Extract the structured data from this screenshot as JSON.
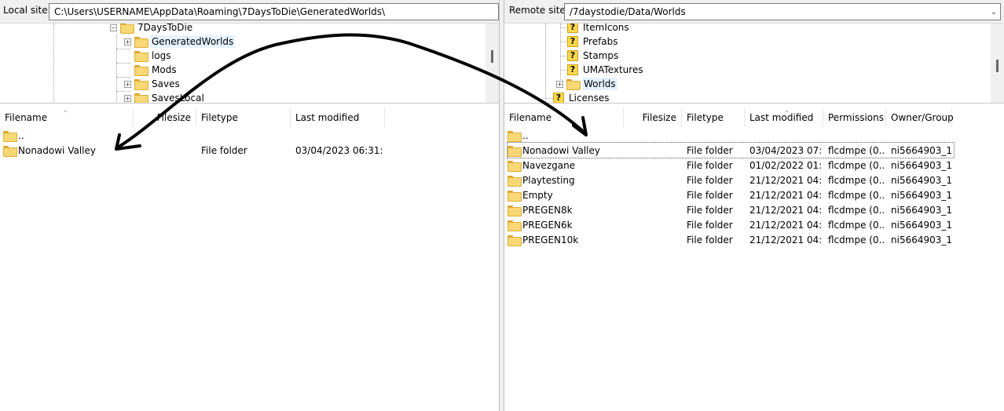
{
  "local": {
    "label": "Local site:",
    "path": "C:\\Users\\USERNAME\\AppData\\Roaming\\7DaysToDie\\GeneratedWorlds\\",
    "tree": [
      {
        "name": "7DaysToDie",
        "expander": "minus",
        "icon": "folder-icon",
        "selected": false
      },
      {
        "name": "GeneratedWorlds",
        "expander": "plus",
        "icon": "folder-icon",
        "selected": true
      },
      {
        "name": "logs",
        "expander": "none",
        "icon": "folder-icon",
        "selected": false
      },
      {
        "name": "Mods",
        "expander": "none",
        "icon": "folder-icon",
        "selected": false
      },
      {
        "name": "Saves",
        "expander": "plus",
        "icon": "folder-icon",
        "selected": false
      },
      {
        "name": "SavesLocal",
        "expander": "plus",
        "icon": "folder-icon",
        "selected": false
      }
    ],
    "columns": [
      "Filename",
      "Filesize",
      "Filetype",
      "Last modified"
    ],
    "files": [
      {
        "name": "..",
        "size": "",
        "type": "",
        "modified": ""
      },
      {
        "name": "Nonadowi Valley",
        "size": "",
        "type": "File folder",
        "modified": "03/04/2023 06:31:1..."
      }
    ]
  },
  "remote": {
    "label": "Remote site:",
    "path": "/7daystodie/Data/Worlds",
    "tree": [
      {
        "name": "ItemIcons",
        "expander": "none",
        "icon": "unknown-folder-icon",
        "selected": false
      },
      {
        "name": "Prefabs",
        "expander": "none",
        "icon": "unknown-folder-icon",
        "selected": false
      },
      {
        "name": "Stamps",
        "expander": "none",
        "icon": "unknown-folder-icon",
        "selected": false
      },
      {
        "name": "UMATextures",
        "expander": "none",
        "icon": "unknown-folder-icon",
        "selected": false
      },
      {
        "name": "Worlds",
        "expander": "plus",
        "icon": "folder-icon",
        "selected": true
      },
      {
        "name": "Licenses",
        "expander": "none",
        "icon": "unknown-folder-icon",
        "selected": false
      }
    ],
    "columns": [
      "Filename",
      "Filesize",
      "Filetype",
      "Last modified",
      "Permissions",
      "Owner/Group"
    ],
    "files": [
      {
        "name": "..",
        "size": "",
        "type": "",
        "modified": "",
        "perms": "",
        "owner": ""
      },
      {
        "name": "Nonadowi Valley",
        "size": "",
        "type": "File folder",
        "modified": "03/04/2023 07:...",
        "perms": "flcdmpe (0...",
        "owner": "ni5664903_1..."
      },
      {
        "name": "Navezgane",
        "size": "",
        "type": "File folder",
        "modified": "01/02/2022 01:...",
        "perms": "flcdmpe (0...",
        "owner": "ni5664903_1..."
      },
      {
        "name": "Playtesting",
        "size": "",
        "type": "File folder",
        "modified": "21/12/2021 04:...",
        "perms": "flcdmpe (0...",
        "owner": "ni5664903_1..."
      },
      {
        "name": "Empty",
        "size": "",
        "type": "File folder",
        "modified": "21/12/2021 04:...",
        "perms": "flcdmpe (0...",
        "owner": "ni5664903_1..."
      },
      {
        "name": "PREGEN8k",
        "size": "",
        "type": "File folder",
        "modified": "21/12/2021 04:...",
        "perms": "flcdmpe (0...",
        "owner": "ni5664903_1..."
      },
      {
        "name": "PREGEN6k",
        "size": "",
        "type": "File folder",
        "modified": "21/12/2021 04:...",
        "perms": "flcdmpe (0...",
        "owner": "ni5664903_1..."
      },
      {
        "name": "PREGEN10k",
        "size": "",
        "type": "File folder",
        "modified": "21/12/2021 04:...",
        "perms": "flcdmpe (0...",
        "owner": "ni5664903_1..."
      }
    ]
  },
  "colors": {
    "selection": "#e5f3ff",
    "folder": "#f8d775",
    "annotation": "#000000"
  }
}
